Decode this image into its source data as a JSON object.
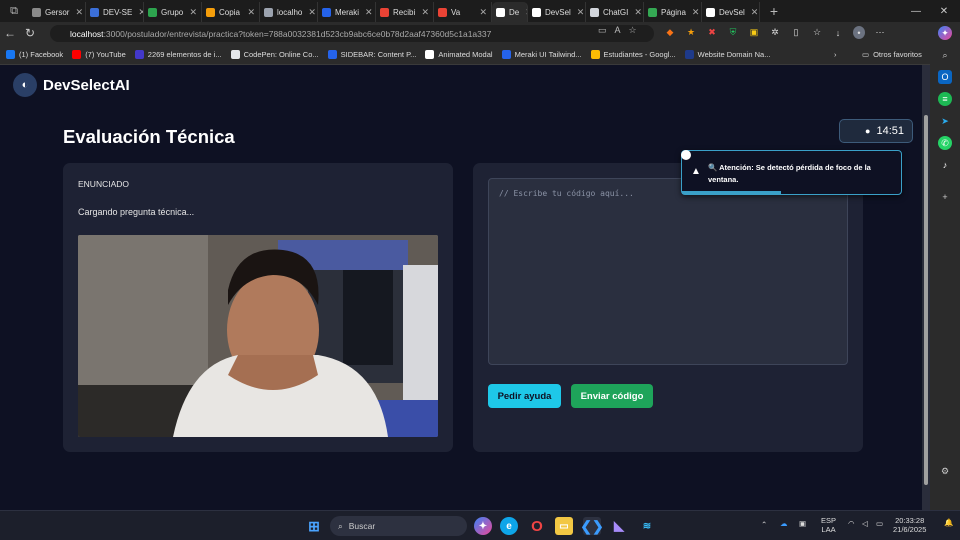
{
  "browser": {
    "tabs": [
      {
        "label": "Gersor",
        "color": "#8a8a8a",
        "active": false
      },
      {
        "label": "DEV-SE",
        "color": "#3b6fd8",
        "active": false
      },
      {
        "label": "Grupo",
        "color": "#2da44e",
        "active": false
      },
      {
        "label": "Copia",
        "color": "#f59e0b",
        "active": false
      },
      {
        "label": "localho",
        "color": "#9ca3af",
        "active": false
      },
      {
        "label": "Meraki",
        "color": "#2563eb",
        "active": false
      },
      {
        "label": "Recibi",
        "color": "#ea4335",
        "active": false
      },
      {
        "label": "Va",
        "color": "#ea4335",
        "active": false
      },
      {
        "label": "De",
        "color": "#ffffff",
        "active": true
      },
      {
        "label": "DevSel",
        "color": "#ffffff",
        "active": false
      },
      {
        "label": "ChatGI",
        "color": "#d1d5db",
        "active": false
      },
      {
        "label": "Página",
        "color": "#34a853",
        "active": false
      },
      {
        "label": "DevSel",
        "color": "#ffffff",
        "active": false
      }
    ],
    "url_host": "localhost",
    "url_path": ":3000/postulador/entrevista/practica?token=788a0032381d523cb9abc6ce0b78d2aaf47360d5c1a1a337",
    "bookmarks": [
      {
        "label": "(1) Facebook",
        "color": "#1877f2"
      },
      {
        "label": "(7) YouTube",
        "color": "#ff0000"
      },
      {
        "label": "2269 elementos de i...",
        "color": "#4338ca"
      },
      {
        "label": "CodePen: Online Co...",
        "color": "#e5e7eb"
      },
      {
        "label": "SIDEBAR: Content P...",
        "color": "#2563eb"
      },
      {
        "label": "Animated Modal",
        "color": "#ffffff"
      },
      {
        "label": "Meraki UI Tailwind...",
        "color": "#2563eb"
      },
      {
        "label": "Estudiantes - Googl...",
        "color": "#fbbc04"
      },
      {
        "label": "Website Domain Na...",
        "color": "#1e3a8a"
      }
    ],
    "other_favorites": "Otros favoritos"
  },
  "app": {
    "brand": "DevSelectAI",
    "page_title": "Evaluación Técnica",
    "timer": "14:51",
    "question_heading": "ENUNCIADO",
    "question_text": "Cargando pregunta técnica...",
    "code_placeholder": "// Escribe tu código aquí...",
    "help_button": "Pedir ayuda",
    "submit_button": "Enviar código",
    "toast": {
      "message": "🔍 Atención: Se detectó pérdida de foco de la ventana.",
      "progress": 0.45
    }
  },
  "taskbar": {
    "search_label": "Buscar",
    "lang_top": "ESP",
    "lang_bottom": "LAA",
    "time": "20:33:28",
    "date": "21/6/2025"
  }
}
